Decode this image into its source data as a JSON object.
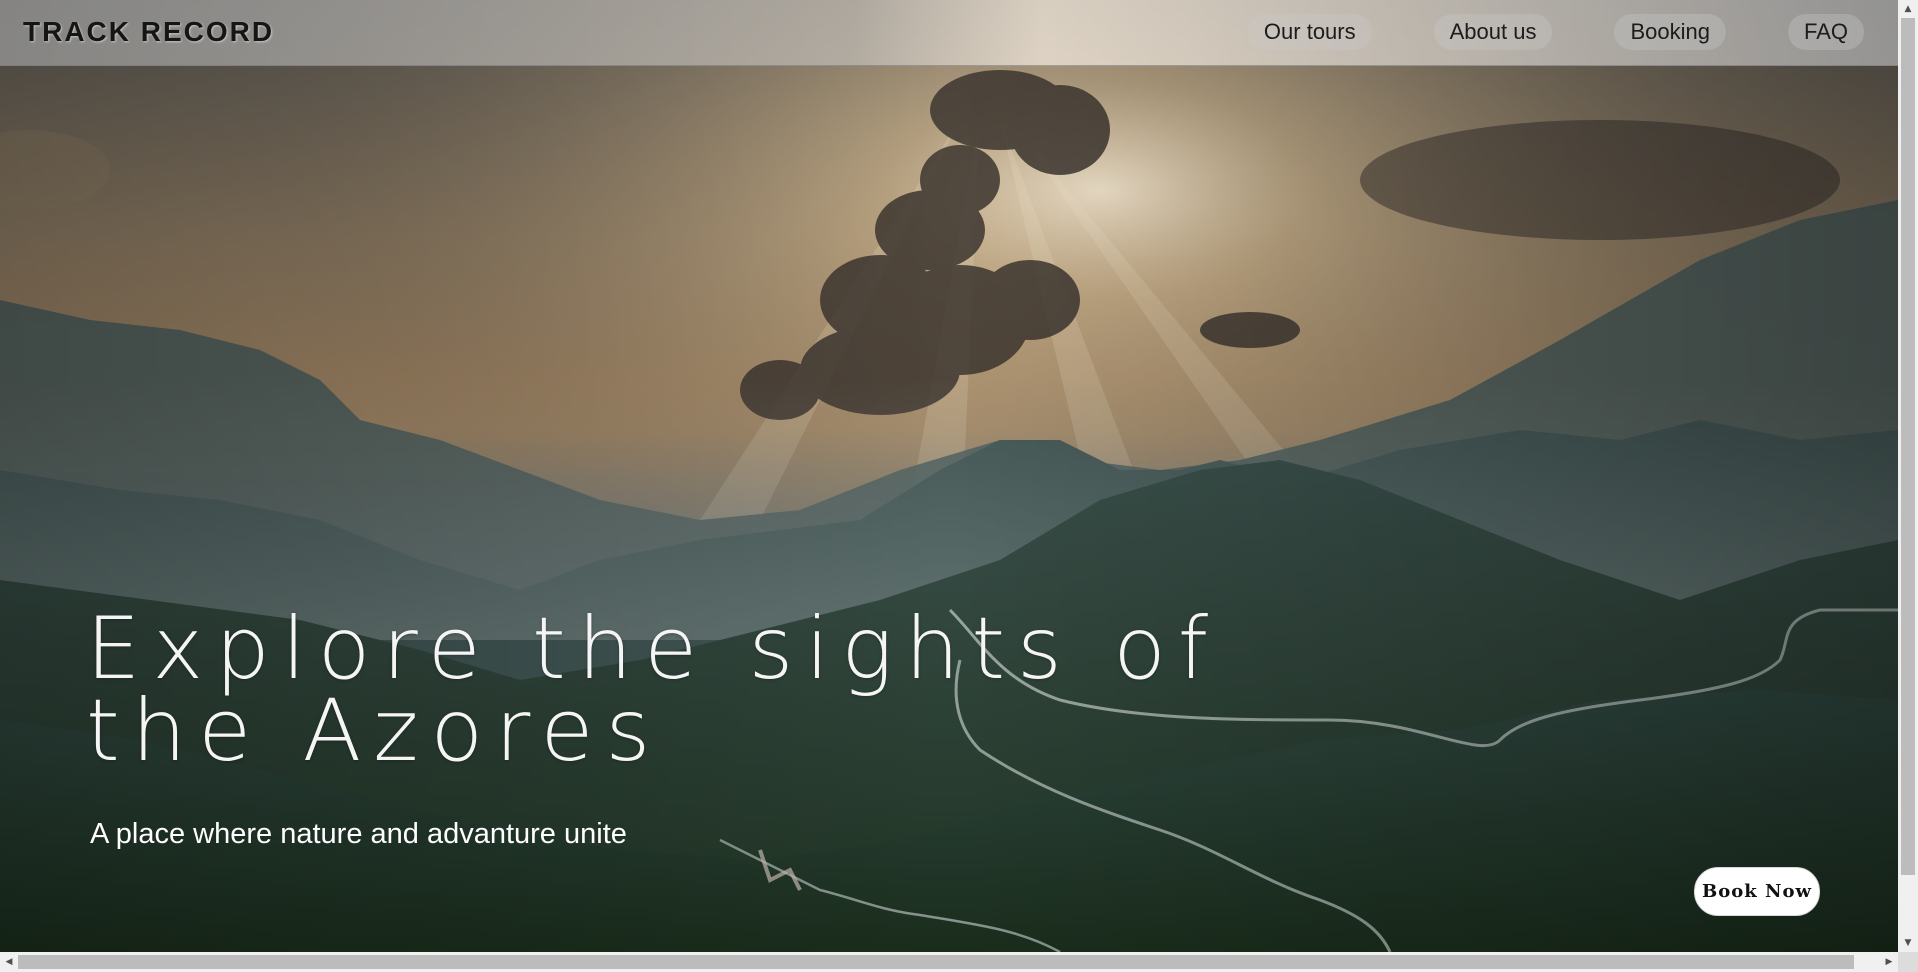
{
  "brand": {
    "logo_text": "TRACK RECORD"
  },
  "nav": {
    "items": [
      {
        "label": "Our tours"
      },
      {
        "label": "About us"
      },
      {
        "label": "Booking"
      },
      {
        "label": "FAQ"
      }
    ]
  },
  "hero": {
    "headline": "Explore the sights of the Azores",
    "subheadline": "A place where nature and advanture unite",
    "cta_label": "Book Now",
    "scene": "mountain-valley-sunrise"
  },
  "scrollbars": {
    "vertical": {
      "up_icon": "arrow-up-icon",
      "down_icon": "arrow-down-icon"
    },
    "horizontal": {
      "left_icon": "arrow-left-icon",
      "right_icon": "arrow-right-icon"
    }
  },
  "colors": {
    "text_light": "#f5f5f5",
    "cta_background": "#ffffff",
    "logo": "#151515"
  }
}
